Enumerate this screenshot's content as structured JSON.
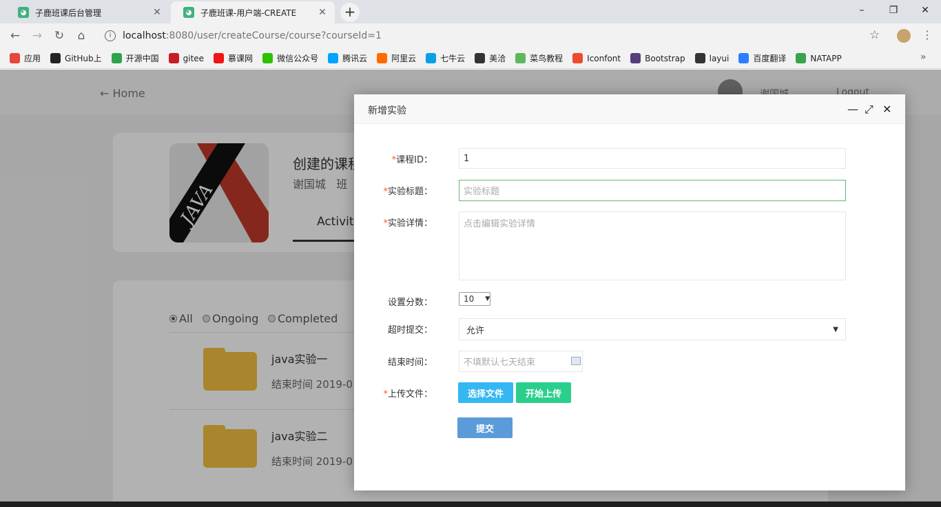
{
  "browser": {
    "tabs": [
      {
        "title": "子鹿班课后台管理",
        "close": "✕"
      },
      {
        "title": "子鹿班课-用户端-CREATE",
        "close": "✕"
      }
    ],
    "new_tab": "+",
    "url_host": "localhost",
    "url_rest": ":8080/user/createCourse/course?courseId=1",
    "window_controls": {
      "minimize": "–",
      "maximize": "❐",
      "close": "✕"
    },
    "nav": {
      "back": "←",
      "forward": "→",
      "reload": "↻",
      "home": "⌂",
      "star": "☆",
      "menu": "⋮"
    },
    "bookmarks": [
      {
        "label": "应用",
        "color": "#e8453c"
      },
      {
        "label": "GitHub上",
        "color": "#222222"
      },
      {
        "label": "开源中国",
        "color": "#2ea44f"
      },
      {
        "label": "gitee",
        "color": "#c71d23"
      },
      {
        "label": "慕课网",
        "color": "#f01414"
      },
      {
        "label": "微信公众号",
        "color": "#2dc100"
      },
      {
        "label": "腾讯云",
        "color": "#00a3ff"
      },
      {
        "label": "阿里云",
        "color": "#ff6a00"
      },
      {
        "label": "七牛云",
        "color": "#0aa0e5"
      },
      {
        "label": "美洽",
        "color": "#333333"
      },
      {
        "label": "菜鸟教程",
        "color": "#5cb85c"
      },
      {
        "label": "Iconfont",
        "color": "#ef4a2d"
      },
      {
        "label": "Bootstrap",
        "color": "#563d7c"
      },
      {
        "label": "layui",
        "color": "#333333"
      },
      {
        "label": "百度翻译",
        "color": "#2b7eff"
      },
      {
        "label": "NATAPP",
        "color": "#3aa24a"
      }
    ],
    "bookmarks_more": "»"
  },
  "site": {
    "home_link": "← Home",
    "user_name": "谢国城",
    "logout": "Logout"
  },
  "course": {
    "title": "创建的课程",
    "teacher": "谢国城",
    "class_prefix": "班",
    "tab_activity": "Activity"
  },
  "filters": [
    {
      "label": "All",
      "selected": true
    },
    {
      "label": "Ongoing",
      "selected": false
    },
    {
      "label": "Completed",
      "selected": false
    }
  ],
  "experiments": [
    {
      "title": "java实验一",
      "end": "结束时间 2019-0"
    },
    {
      "title": "java实验二",
      "end": "结束时间 2019-0"
    }
  ],
  "dialog": {
    "title": "新增实验",
    "controls": {
      "minimize": "—",
      "maximize": "⤢",
      "close": "✕"
    },
    "required_mark": "*",
    "fields": {
      "course_id": {
        "label": "课程ID：",
        "value": "1"
      },
      "exp_title": {
        "label": "实验标题：",
        "placeholder": "实验标题"
      },
      "exp_detail": {
        "label": "实验详情：",
        "placeholder": "点击编辑实验详情"
      },
      "score": {
        "label": "设置分数：",
        "value": "10"
      },
      "overtime": {
        "label": "超时提交：",
        "value": "允许"
      },
      "end_time": {
        "label": "结束时间：",
        "placeholder": "不填默认七天结束"
      },
      "upload": {
        "label": "上传文件："
      }
    },
    "buttons": {
      "choose_file": "选择文件",
      "start_upload": "开始上传",
      "submit": "提交"
    },
    "colors": {
      "choose": "#35b7f1",
      "upload": "#2bcf8d",
      "submit": "#5b9bd9"
    }
  }
}
